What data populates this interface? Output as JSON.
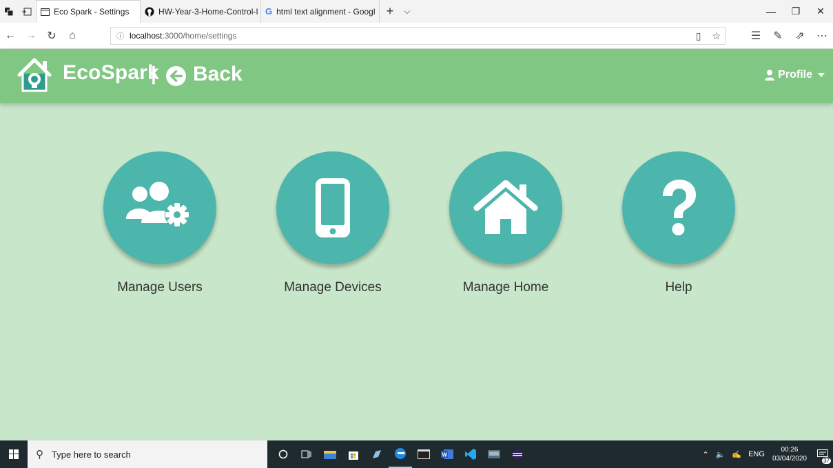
{
  "browser": {
    "tabs": [
      {
        "title": "Eco Spark - Settings",
        "active": true
      },
      {
        "title": "HW-Year-3-Home-Control-I",
        "active": false
      },
      {
        "title": "html text alignment - Googl",
        "active": false
      }
    ],
    "url_host": "localhost",
    "url_path": ":3000/home/settings"
  },
  "header": {
    "brand": "EcoSpark",
    "separator": "|",
    "back_label": "Back",
    "profile_label": "Profile"
  },
  "tiles": [
    {
      "label": "Manage Users",
      "icon": "users-gear-icon"
    },
    {
      "label": "Manage Devices",
      "icon": "mobile-phone-icon"
    },
    {
      "label": "Manage Home",
      "icon": "home-icon"
    },
    {
      "label": "Help",
      "icon": "question-icon"
    }
  ],
  "taskbar": {
    "search_placeholder": "Type here to search",
    "language": "ENG",
    "time": "00:26",
    "date": "03/04/2020",
    "notifications": "37"
  },
  "colors": {
    "header_bg": "#81c784",
    "page_bg": "#c8e6c9",
    "tile_circle": "#4db6ac"
  }
}
